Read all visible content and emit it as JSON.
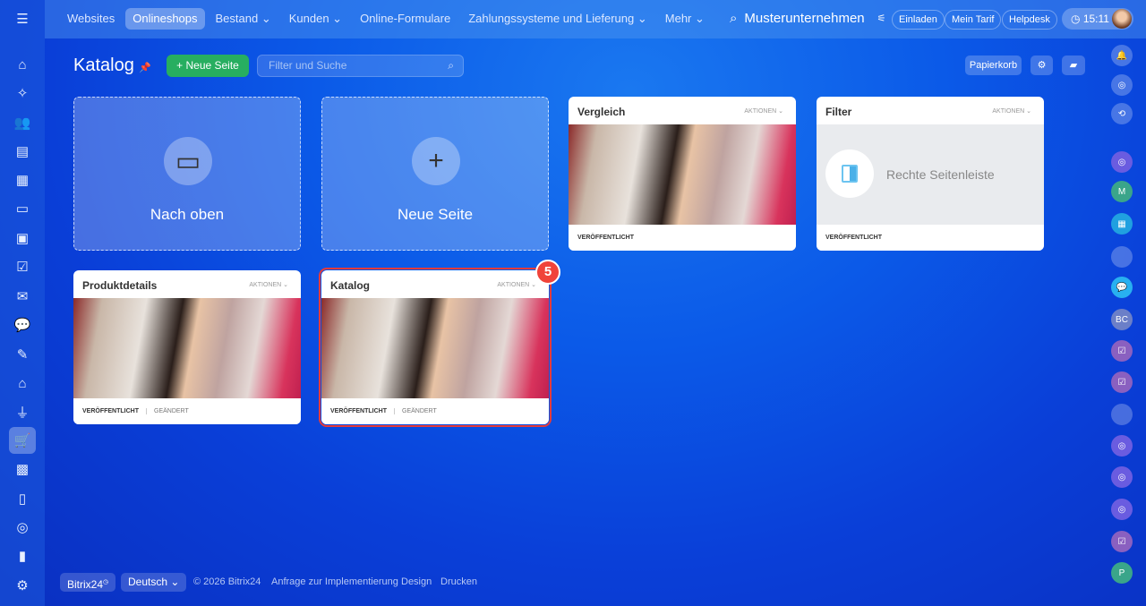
{
  "nav": {
    "items": [
      "Websites",
      "Onlineshops",
      "Bestand",
      "Kunden",
      "Online-Formulare",
      "Zahlungssysteme und Lieferung",
      "Mehr"
    ],
    "active": "Onlineshops"
  },
  "header": {
    "company": "Musterunternehmen",
    "invite": "Einladen",
    "tariff": "Mein Tarif",
    "helpdesk": "Helpdesk",
    "time": "15:11"
  },
  "page": {
    "title": "Katalog",
    "new_page": "+ Neue Seite",
    "search_placeholder": "Filter und Suche",
    "trash": "Papierkorb"
  },
  "cards": [
    {
      "type": "action",
      "label": "Nach oben",
      "icon": "folder-up-icon"
    },
    {
      "type": "action",
      "label": "Neue Seite",
      "icon": "plus-icon"
    },
    {
      "title": "Vergleich",
      "actions": "AKTIONEN",
      "status": "VERÖFFENTLICHT"
    },
    {
      "title": "Filter",
      "actions": "AKTIONEN",
      "status": "VERÖFFENTLICHT",
      "placeholder": "Rechte Seitenleiste"
    },
    {
      "title": "Produktdetails",
      "actions": "AKTIONEN",
      "status": "VERÖFFENTLICHT",
      "modified": "GEÄNDERT"
    },
    {
      "title": "Katalog",
      "actions": "AKTIONEN",
      "status": "VERÖFFENTLICHT",
      "modified": "GEÄNDERT",
      "selected": true
    }
  ],
  "badge": "5",
  "right_sidebar": {
    "initials": [
      "M",
      "BC",
      "P"
    ]
  },
  "footer": {
    "brand": "Bitrix24",
    "language": "Deutsch",
    "copyright": "© 2026 Bitrix24",
    "links": [
      "Anfrage zur Implementierung",
      "Design",
      "Drucken"
    ]
  },
  "colors": {
    "accent_green": "#27ae60",
    "badge_red": "#f0433a"
  }
}
